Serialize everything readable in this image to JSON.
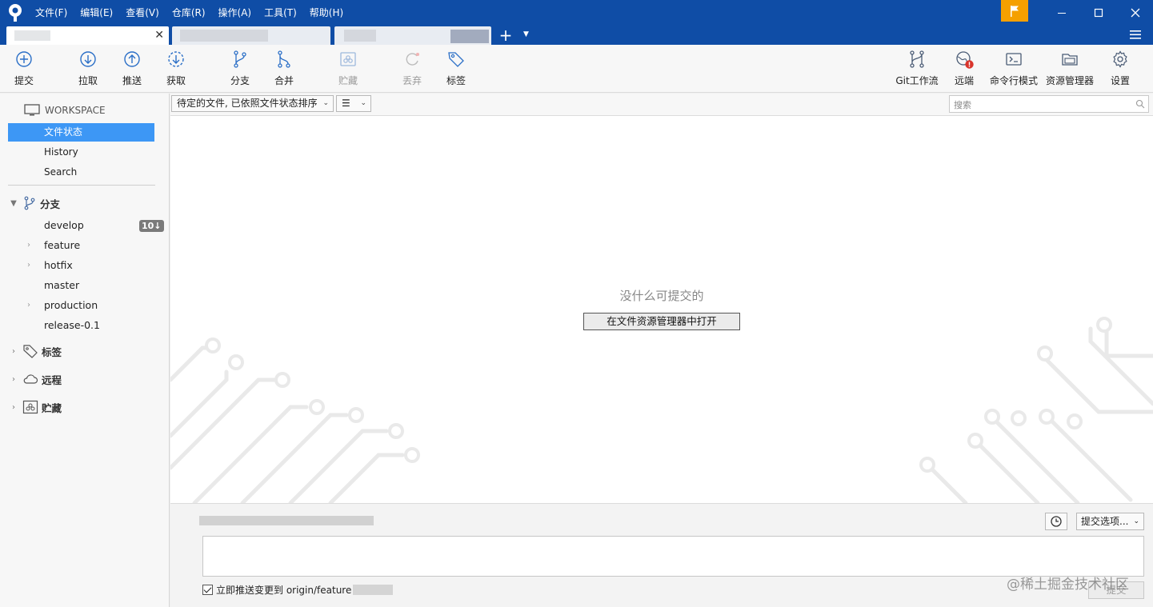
{
  "menu": [
    "文件(F)",
    "编辑(E)",
    "查看(V)",
    "仓库(R)",
    "操作(A)",
    "工具(T)",
    "帮助(H)"
  ],
  "toolbar": {
    "commit": "提交",
    "pull": "拉取",
    "push": "推送",
    "fetch": "获取",
    "branch": "分支",
    "merge": "合并",
    "stash": "贮藏",
    "discard": "丢弃",
    "tag": "标签",
    "gitflow": "Git工作流",
    "remote": "远端",
    "terminal": "命令行模式",
    "explorer": "资源管理器",
    "settings": "设置"
  },
  "sidebar": {
    "workspace": "WORKSPACE",
    "items": [
      "文件状态",
      "History",
      "Search"
    ],
    "branches_label": "分支",
    "branches": [
      "develop",
      "feature",
      "hotfix",
      "master",
      "production",
      "release-0.1"
    ],
    "develop_badge": "10↓",
    "tags_label": "标签",
    "remotes_label": "远程",
    "stashes_label": "贮藏"
  },
  "filter": {
    "sort_label": "待定的文件, 已依照文件状态排序",
    "view_label": "☰",
    "search_placeholder": "搜索"
  },
  "content": {
    "empty_message": "没什么可提交的",
    "open_button": "在文件资源管理器中打开"
  },
  "commit": {
    "options_label": "提交选项...",
    "push_checkbox_label": "立即推送变更到 origin/feature",
    "push_checked": true,
    "submit_label": "提交"
  },
  "watermark": "@稀土掘金技术社区",
  "colors": {
    "titlebar": "#0f4da6",
    "selection": "#3d97f5",
    "flag": "#f5a000"
  }
}
